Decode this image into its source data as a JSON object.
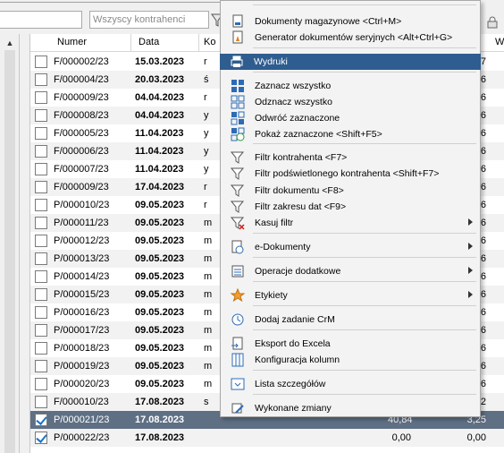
{
  "toolbar": {
    "search_placeholder": "Wszyscy kontrahenci"
  },
  "grid": {
    "columns": [
      "Numer",
      "Data",
      "Ko",
      "W"
    ],
    "rows": [
      {
        "checked": false,
        "numer": "F/000002/23",
        "data": "15.03.2023",
        "k": "r",
        "v1": "",
        "v2": "7"
      },
      {
        "checked": false,
        "numer": "F/000004/23",
        "data": "20.03.2023",
        "k": "ś",
        "v1": "",
        "v2": "6"
      },
      {
        "checked": false,
        "numer": "F/000009/23",
        "data": "04.04.2023",
        "k": "r",
        "v1": "",
        "v2": "6"
      },
      {
        "checked": false,
        "numer": "F/000008/23",
        "data": "04.04.2023",
        "k": "y",
        "v1": "",
        "v2": "6"
      },
      {
        "checked": false,
        "numer": "F/000005/23",
        "data": "11.04.2023",
        "k": "y",
        "v1": "",
        "v2": "6"
      },
      {
        "checked": false,
        "numer": "F/000006/23",
        "data": "11.04.2023",
        "k": "y",
        "v1": "",
        "v2": "6"
      },
      {
        "checked": false,
        "numer": "F/000007/23",
        "data": "11.04.2023",
        "k": "y",
        "v1": "",
        "v2": "6"
      },
      {
        "checked": false,
        "numer": "F/000009/23",
        "data": "17.04.2023",
        "k": "r",
        "v1": "",
        "v2": "6"
      },
      {
        "checked": false,
        "numer": "P/000010/23",
        "data": "09.05.2023",
        "k": "r",
        "v1": "",
        "v2": "6"
      },
      {
        "checked": false,
        "numer": "P/000011/23",
        "data": "09.05.2023",
        "k": "m",
        "v1": "",
        "v2": "6"
      },
      {
        "checked": false,
        "numer": "P/000012/23",
        "data": "09.05.2023",
        "k": "m",
        "v1": "",
        "v2": "6"
      },
      {
        "checked": false,
        "numer": "P/000013/23",
        "data": "09.05.2023",
        "k": "m",
        "v1": "",
        "v2": "6"
      },
      {
        "checked": false,
        "numer": "P/000014/23",
        "data": "09.05.2023",
        "k": "m",
        "v1": "",
        "v2": "6"
      },
      {
        "checked": false,
        "numer": "P/000015/23",
        "data": "09.05.2023",
        "k": "m",
        "v1": "",
        "v2": "6"
      },
      {
        "checked": false,
        "numer": "P/000016/23",
        "data": "09.05.2023",
        "k": "m",
        "v1": "",
        "v2": "6"
      },
      {
        "checked": false,
        "numer": "P/000017/23",
        "data": "09.05.2023",
        "k": "m",
        "v1": "",
        "v2": "6"
      },
      {
        "checked": false,
        "numer": "P/000018/23",
        "data": "09.05.2023",
        "k": "m",
        "v1": "",
        "v2": "6"
      },
      {
        "checked": false,
        "numer": "P/000019/23",
        "data": "09.05.2023",
        "k": "m",
        "v1": "",
        "v2": "6"
      },
      {
        "checked": false,
        "numer": "P/000020/23",
        "data": "09.05.2023",
        "k": "m",
        "v1": "",
        "v2": "6"
      },
      {
        "checked": false,
        "numer": "F/000010/23",
        "data": "17.08.2023",
        "k": "s",
        "v1": "",
        "v2": "2"
      },
      {
        "checked": true,
        "numer": "P/000021/23",
        "data": "17.08.2023",
        "k": "",
        "v1": "40,84",
        "v2": "3,25",
        "selected": true
      },
      {
        "checked": true,
        "numer": "P/000022/23",
        "data": "17.08.2023",
        "k": "",
        "v1": "0,00",
        "v2": "0,00"
      }
    ]
  },
  "context_menu": {
    "items": [
      {
        "label": "Dokumenty magazynowe <Ctrl+M>",
        "icon": "warehouse-docs-icon"
      },
      {
        "label": "Generator dokumentów seryjnych <Alt+Ctrl+G>",
        "icon": "generator-icon"
      },
      {
        "label": "Wydruki",
        "icon": "printer-icon",
        "highlighted": true
      },
      {
        "label": "Zaznacz wszystko",
        "icon": "select-all-icon"
      },
      {
        "label": "Odznacz wszystko",
        "icon": "deselect-all-icon"
      },
      {
        "label": "Odwróć zaznaczone",
        "icon": "invert-selection-icon"
      },
      {
        "label": "Pokaż zaznaczone <Shift+F5>",
        "icon": "show-selected-icon"
      },
      {
        "label": "Filtr kontrahenta <F7>",
        "icon": "filter-contractor-icon"
      },
      {
        "label": "Filtr podświetlonego kontrahenta <Shift+F7>",
        "icon": "filter-highlighted-icon"
      },
      {
        "label": "Filtr dokumentu <F8>",
        "icon": "filter-document-icon"
      },
      {
        "label": "Filtr zakresu dat <F9>",
        "icon": "filter-dates-icon"
      },
      {
        "label": "Kasuj filtr",
        "icon": "clear-filter-icon",
        "submenu": true
      },
      {
        "label": "e-Dokumenty",
        "icon": "e-documents-icon",
        "submenu": true
      },
      {
        "label": "Operacje dodatkowe",
        "icon": "operations-icon",
        "submenu": true
      },
      {
        "label": "Etykiety",
        "icon": "star-icon",
        "submenu": true
      },
      {
        "label": "Dodaj zadanie CrM",
        "icon": "crm-task-icon"
      },
      {
        "label": "Eksport do Excela",
        "icon": "excel-export-icon"
      },
      {
        "label": "Konfiguracja kolumn",
        "icon": "columns-config-icon"
      },
      {
        "label": "Lista szczegółów",
        "icon": "details-list-icon"
      },
      {
        "label": "Wykonane zmiany",
        "icon": "changes-icon"
      }
    ]
  }
}
